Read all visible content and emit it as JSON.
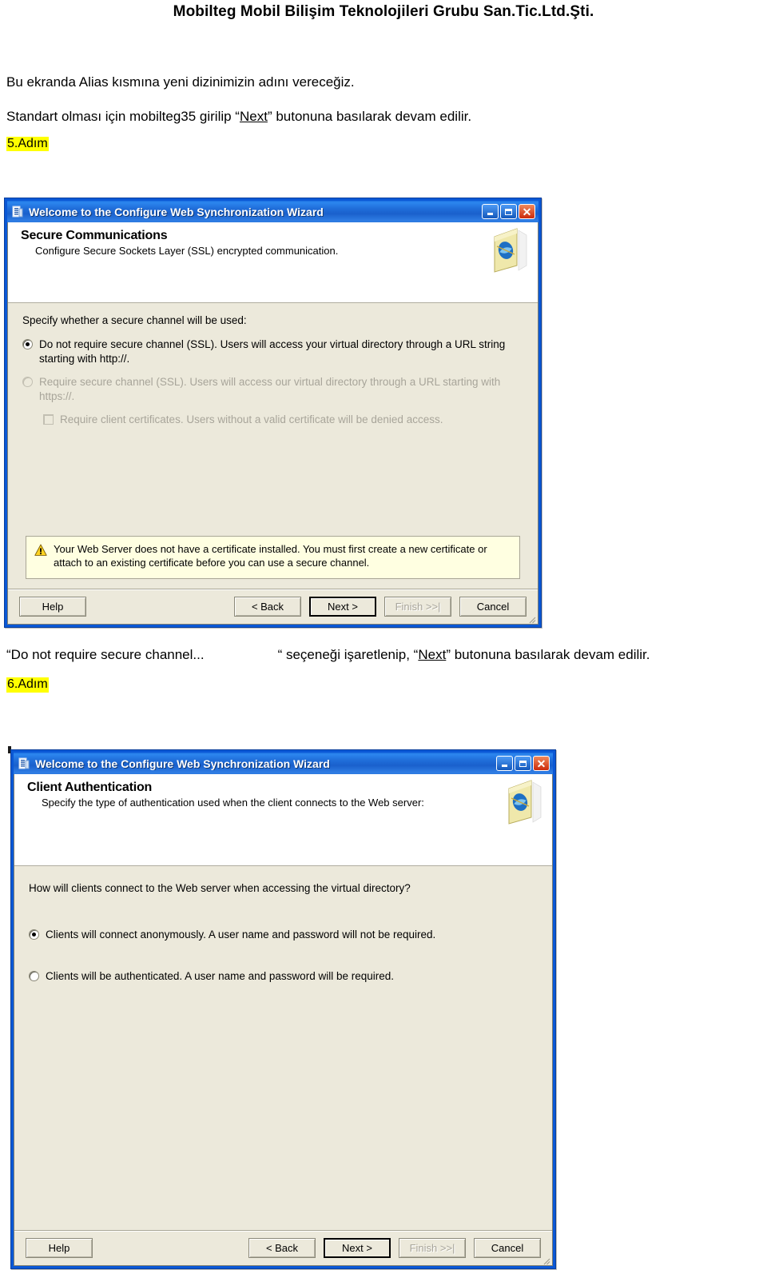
{
  "document": {
    "header_title": "Mobilteg Mobil Bilişim Teknolojileri Grubu San.Tic.Ltd.Şti.",
    "intro_line_1": "Bu ekranda Alias kısmına yeni dizinimizin adını vereceğiz.",
    "intro_line_2_before": "Standart olması için mobilteg35 girilip “",
    "intro_line_2_link": "Next",
    "intro_line_2_after": "” butonuna basılarak devam edilir.",
    "step_5_label": "5.Adım",
    "step_6_label": "6.Adım",
    "mid_caption_part1": "“Do not require secure channel...",
    "mid_caption_part2": "“ seçeneği işaretlenip, “",
    "mid_caption_link": "Next",
    "mid_caption_part3": "” butonuna basılarak devam edilir."
  },
  "dialog_secure": {
    "title": "Welcome to the Configure Web Synchronization Wizard",
    "title_icon": "wizard-icon",
    "window_buttons": {
      "minimize": "minimize-icon",
      "maximize": "maximize-icon",
      "close": "close-icon"
    },
    "banner": {
      "heading": "Secure Communications",
      "subtext": "Configure Secure Sockets Layer (SSL) encrypted communication.",
      "icon": "web-folder-icon"
    },
    "prompt": "Specify whether a secure channel will be used:",
    "options": [
      {
        "label": "Do not require secure channel (SSL). Users will access your virtual directory through a URL string starting with http://.",
        "checked": true,
        "disabled": false
      },
      {
        "label": "Require secure channel (SSL).  Users will access our virtual directory through a URL starting with https://.",
        "checked": false,
        "disabled": true
      }
    ],
    "checkbox": {
      "label": "Require client certificates.  Users without a valid certificate will be denied access.",
      "checked": false,
      "disabled": true
    },
    "warning": {
      "icon": "warning-triangle-icon",
      "text": "Your Web Server does not have a certificate installed.  You must first create a new certificate or attach to an existing certificate before you can use a secure channel."
    },
    "footer_buttons": [
      {
        "label": "Help",
        "state": "normal"
      },
      {
        "label": "< Back",
        "state": "normal"
      },
      {
        "label": "Next >",
        "state": "default"
      },
      {
        "label": "Finish >>|",
        "state": "disabled"
      },
      {
        "label": "Cancel",
        "state": "normal"
      }
    ]
  },
  "dialog_client_auth": {
    "title": "Welcome to the Configure Web Synchronization Wizard",
    "title_icon": "wizard-icon",
    "window_buttons": {
      "minimize": "minimize-icon",
      "maximize": "maximize-icon",
      "close": "close-icon"
    },
    "banner": {
      "heading": "Client Authentication",
      "subtext": "Specify the type of authentication used when the client connects to the Web server:",
      "icon": "web-folder-icon"
    },
    "prompt": "How will clients connect to the Web server when accessing the virtual directory?",
    "options": [
      {
        "label": "Clients will connect anonymously. A user name and password will not be required.",
        "checked": true,
        "disabled": false
      },
      {
        "label": "Clients will be authenticated. A user name and password will be required.",
        "checked": false,
        "disabled": false
      }
    ],
    "footer_buttons": [
      {
        "label": "Help",
        "state": "normal"
      },
      {
        "label": "< Back",
        "state": "normal"
      },
      {
        "label": "Next >",
        "state": "default"
      },
      {
        "label": "Finish >>|",
        "state": "disabled"
      },
      {
        "label": "Cancel",
        "state": "normal"
      }
    ]
  },
  "colors": {
    "titlebar_blue": "#1f6cd8",
    "window_frame_blue": "#0a58d6",
    "dialog_face": "#ece9db",
    "warning_bg": "#ffffe1",
    "highlight_yellow": "#ffff00",
    "close_red": "#cc2a0c"
  }
}
